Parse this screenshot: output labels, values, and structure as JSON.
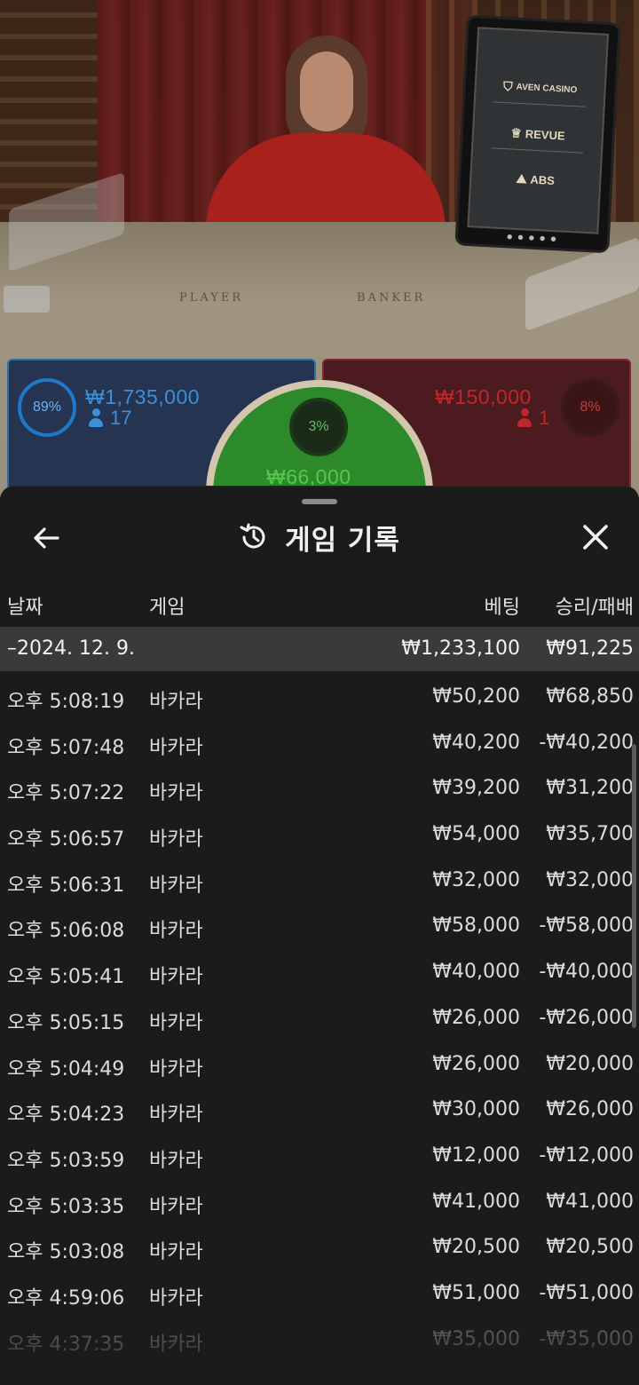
{
  "video": {
    "table_labels": {
      "player": "PLAYER",
      "banker": "BANKER"
    },
    "monitor_sponsors": [
      {
        "name": "AVEN CASINO",
        "icon": "aven-shield-icon"
      },
      {
        "name": "REVUE",
        "icon": "revue-crest-icon"
      },
      {
        "name": "ABS",
        "icon": "abs-logo-icon"
      }
    ]
  },
  "bets": {
    "player": {
      "percent": "89%",
      "amount": "₩1,735,000",
      "players": "17",
      "color": "#3d8fda"
    },
    "tie": {
      "percent": "3%",
      "amount": "₩66,000",
      "color": "#57c84f"
    },
    "banker": {
      "percent": "8%",
      "amount": "₩150,000",
      "players": "1",
      "color": "#c0262a"
    }
  },
  "sheet": {
    "title": "게임 기록",
    "title_icon": "history-icon",
    "back_icon": "arrow-left-icon",
    "close_icon": "close-icon",
    "columns": {
      "date": "날짜",
      "game": "게임",
      "bet": "베팅",
      "result": "승리/패배"
    },
    "summary": {
      "date": "–2024. 12. 9.",
      "bet": "₩1,233,100",
      "result": "₩91,225"
    },
    "rows": [
      {
        "time": "오후 5:08:19",
        "game": "바카라",
        "bet": "₩50,200",
        "result": "₩68,850"
      },
      {
        "time": "오후 5:07:48",
        "game": "바카라",
        "bet": "₩40,200",
        "result": "-₩40,200"
      },
      {
        "time": "오후 5:07:22",
        "game": "바카라",
        "bet": "₩39,200",
        "result": "₩31,200"
      },
      {
        "time": "오후 5:06:57",
        "game": "바카라",
        "bet": "₩54,000",
        "result": "₩35,700"
      },
      {
        "time": "오후 5:06:31",
        "game": "바카라",
        "bet": "₩32,000",
        "result": "₩32,000"
      },
      {
        "time": "오후 5:06:08",
        "game": "바카라",
        "bet": "₩58,000",
        "result": "-₩58,000"
      },
      {
        "time": "오후 5:05:41",
        "game": "바카라",
        "bet": "₩40,000",
        "result": "-₩40,000"
      },
      {
        "time": "오후 5:05:15",
        "game": "바카라",
        "bet": "₩26,000",
        "result": "-₩26,000"
      },
      {
        "time": "오후 5:04:49",
        "game": "바카라",
        "bet": "₩26,000",
        "result": "₩20,000"
      },
      {
        "time": "오후 5:04:23",
        "game": "바카라",
        "bet": "₩30,000",
        "result": "₩26,000"
      },
      {
        "time": "오후 5:03:59",
        "game": "바카라",
        "bet": "₩12,000",
        "result": "-₩12,000"
      },
      {
        "time": "오후 5:03:35",
        "game": "바카라",
        "bet": "₩41,000",
        "result": "₩41,000"
      },
      {
        "time": "오후 5:03:08",
        "game": "바카라",
        "bet": "₩20,500",
        "result": "₩20,500"
      },
      {
        "time": "오후 4:59:06",
        "game": "바카라",
        "bet": "₩51,000",
        "result": "-₩51,000"
      },
      {
        "time": "오후 4:37:35",
        "game": "바카라",
        "bet": "₩35,000",
        "result": "-₩35,000"
      }
    ]
  }
}
